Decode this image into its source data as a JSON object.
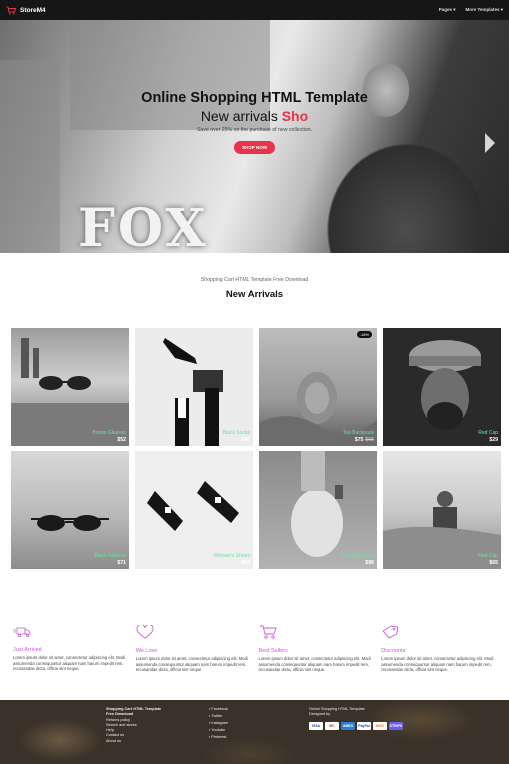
{
  "navbar": {
    "brand": "StoreM4",
    "links": [
      "Pages",
      "More Templates"
    ]
  },
  "hero": {
    "bg_word": "FOX",
    "title": "Online Shopping HTML Template",
    "subtitle_prefix": "New arrivals ",
    "subtitle_accent": "Sho",
    "description": "Save over 25% on the purchase of new collection.",
    "cta": "SHOP NOW"
  },
  "arrivals": {
    "subtitle": "Shopping Cart HTML Template Free Download",
    "title": "New Arrivals",
    "products": [
      {
        "name": "Brown Glasses",
        "price": "$52",
        "old_price": "",
        "badge": ""
      },
      {
        "name": "Black Socks",
        "price": "$46",
        "old_price": "",
        "badge": ""
      },
      {
        "name": "Tea Backpack",
        "price": "$75",
        "old_price": "$96",
        "badge": "-18%"
      },
      {
        "name": "Red Cap",
        "price": "$29",
        "old_price": "",
        "badge": ""
      },
      {
        "name": "Black Glasses",
        "price": "$71",
        "old_price": "",
        "badge": ""
      },
      {
        "name": "Women's Shoes",
        "price": "$43",
        "old_price": "",
        "badge": ""
      },
      {
        "name": "Pink Backpack",
        "price": "$96",
        "old_price": "",
        "badge": ""
      },
      {
        "name": "Red Cap",
        "price": "$65",
        "old_price": "",
        "badge": ""
      }
    ]
  },
  "features": [
    {
      "title": "Just Arrived",
      "desc": "Lorem ipsum dolor sit amet, consectetur adipiscing elit. Modi assumenda consequuntur aliquam nam harum impedit rem, recusandae dicta, officia sint neque."
    },
    {
      "title": "We Love",
      "desc": "Lorem ipsum dolor sit amet, consectetur adipiscing elit. Modi assumenda consequuntur aliquam nam harum impedit rem, recusandae dicta, officia sint neque."
    },
    {
      "title": "Best Sellers",
      "desc": "Lorem ipsum dolor sit amet, consectetur adipiscing elit. Modi assumenda consequuntur aliquam nam harum impedit rem, recusandae dicta, officia sint neque."
    },
    {
      "title": "Discounts",
      "desc": "Lorem ipsum dolor sit amet, consectetur adipiscing elit. Modi assumenda consequuntur aliquam nam harum impedit rem, recusandae dicta, officia sint neque."
    }
  ],
  "footer": {
    "col1_title": "Shopping Cart HTML Template Free Download",
    "col1_links": [
      "Returns policy",
      "Search and stores",
      "Help",
      "Contact us",
      "About us"
    ],
    "col2_links": [
      "Facebook",
      "Twitter",
      "Instagram",
      "Youtube",
      "Pinterest"
    ],
    "col3_title": "Online Shopping HTML Template",
    "col3_credit": "Designed by",
    "payments": [
      "VISA",
      "MC",
      "AMEX",
      "PayPal",
      "DISC",
      "STRIPE"
    ]
  },
  "colors": {
    "accent": "#e8334a",
    "feature": "#c85bd6",
    "product_name": "#6fe0a0"
  }
}
